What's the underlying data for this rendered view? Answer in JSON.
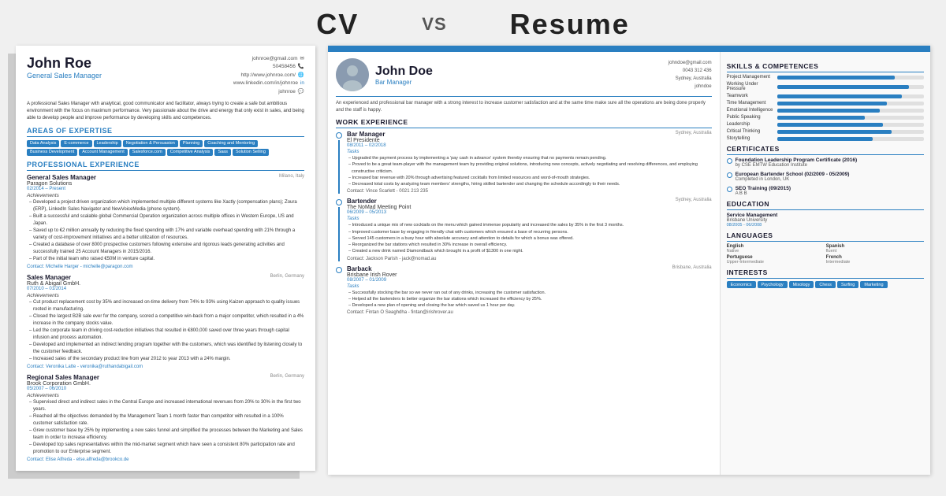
{
  "header": {
    "cv_label": "CV",
    "vs_label": "VS",
    "resume_label": "Resume"
  },
  "cv": {
    "name": "John Roe",
    "title": "General Sales Manager",
    "contact": {
      "email": "johnroe@gmail.com",
      "phone": "50458456",
      "website": "http://www.johnroe.com/",
      "linkedin": "www.linkedin.com/in/johnroe",
      "skype": "johnroe"
    },
    "summary": "A professional Sales Manager with analytical, good communicator and facilitator, always trying to create a safe but ambitious environment with the focus on maximum performance. Very passionate about the drive and energy that only exist in sales, and being able to develop people and improve performance by developing skills and competences.",
    "sections": {
      "expertise": "AREAS OF EXPERTISE",
      "experience": "PROFESSIONAL EXPERIENCE"
    },
    "tags": [
      "Data Analysis",
      "E-commerce",
      "Leadership",
      "Negotiation & Persuasion",
      "Planning",
      "Coaching and Mentoring",
      "Business Development",
      "Account Management",
      "Salesforce.com",
      "Competitive Analysis",
      "Saas",
      "Solution Selling"
    ],
    "jobs": [
      {
        "title": "General Sales Manager",
        "company": "Paragon Solutions",
        "dates": "02/2014 – Present",
        "location": "Milano, Italy",
        "achievements": [
          "Developed a project driven organization which implemented multiple different systems like Xactly (compensation plans); Zoura (ERP), LinkedIn Sales Navigator and NewVoiceMedia (phone system).",
          "Built a successful and scalable global Commercial Operation organization across multiple offices in Western Europe, US and Japan.",
          "Saved up to €2 million annually by reducing the fixed spending with 17% and variable overhead spending with 21% through a variety of cost-improvement initiatives and a better utilization of resources.",
          "Created a database of over 8000 prospective customers following extensive and rigorous leads generating activities and successfully trained 25 Account Managers in 2015/2016.",
          "Part of the initial team who raised €50M in venture capital."
        ],
        "contact": "Michelle Harger - michelle@paragon.com"
      },
      {
        "title": "Sales Manager",
        "company": "Ruth & Abigail GmbH.",
        "dates": "07/2010 – 01/2014",
        "location": "Berlin, Germany",
        "achievements": [
          "Cut product replacement cost by 35% and increased on-time delivery from 74% to 93% using Kaizen approach to quality issues rooted in manufacturing.",
          "Closed the largest B2B sale ever for the company, scored a competitive win-back from a major competitor, which resulted in a 4% increase in the company stocks value.",
          "Led the corporate team in driving cost-reduction initiatives that resulted in €800,000 saved over three years through capital infusion and process automation.",
          "Developed and implemented an indirect lending program together with the customers, which was identified by listening closely to the customer feedback.",
          "Increased sales of the secondary product line from year 2012 to year 2013 with a 24% margin."
        ],
        "contact": "Veronika Latte - veronika@ruthandabigail.com"
      },
      {
        "title": "Regional Sales Manager",
        "company": "Brook Corporation GmbH.",
        "dates": "05/2007 – 06/2010",
        "location": "Berlin, Germany",
        "achievements": [
          "Supervised direct and indirect sales in the Central Europe and increased international revenues from 20% to 30% in the first two years.",
          "Reached all the objectives demanded by the Management Team 1 month faster than competitor with resulted in a 100% customer satisfaction rate.",
          "Grew customer base by 25% by implementing a new sales funnel and simplified the processes between the Marketing and Sales team in order to increase efficiency.",
          "Developed top sales representatives within the mid-market segment which have seen a consistent 80% participation rate and promotion to our Enterprise segment."
        ],
        "contact": "Elise Alfreda - else.alfreda@brookco.de"
      }
    ]
  },
  "resume": {
    "name": "John Doe",
    "title": "Bar Manager",
    "contact": {
      "email": "johndoe@gmail.com",
      "phone": "0043 312 436",
      "location": "Sydney, Australia",
      "social": "johndoe"
    },
    "summary": "An experienced and professional bar manager with a strong interest to increase customer satisfaction and at the same time make sure all the operations are being done properly and the staff is happy.",
    "sections": {
      "work": "WORK EXPERIENCE",
      "skills": "SKILLS & COMPETENCES",
      "certificates": "CERTIFICATES",
      "education": "EDUCATION",
      "languages": "LANGUAGES",
      "interests": "INTERESTS"
    },
    "jobs": [
      {
        "title": "Bar Manager",
        "company": "El Presidente",
        "dates": "08/2011 – 02/2018",
        "location": "Sydney, Australia",
        "tasks": [
          "Upgraded the payment process by implementing a 'pay cash in advance' system thereby ensuring that no payments remain pending.",
          "Proved to be a great team-player with the management team by providing original solutions, introducing new concepts, actively negotiating and resolving differences, and employing constructive criticism.",
          "Increased bar revenue with 20% through advertising featured cocktails from limited resources and word-of-mouth strategies.",
          "Decreased total costs by analyzing team members' strengths, hiring skilled bartender and changing the schedule accordingly to their needs."
        ],
        "contact": "Vince Scarlett - 0021 213 235"
      },
      {
        "title": "Bartender",
        "company": "The NoMad Meeting Point",
        "dates": "06/2009 – 05/2013",
        "location": "Sydney, Australia",
        "tasks": [
          "Introduced a unique mix of new cocktails on the menu which gained immense popularity and increased the sales by 35% in the first 3 months.",
          "Improved customer base by engaging in friendly chat with customers which ensured a base of recurring persons.",
          "Served 145 customers in a busy hour with absolute accuracy and attention to details for which a bonus was offered.",
          "Reorganized the bar stations which resulted in 30% increase in overall efficiency.",
          "Created a new drink named Diamondback which brought in a profit of $1300 in one night."
        ],
        "contact": "Jackson Parish - jack@nomad.au"
      },
      {
        "title": "Barback",
        "company": "Brisbane Irish Rover",
        "dates": "08/2007 – 01/2009",
        "location": "Brisbane, Australia",
        "tasks": [
          "Successfully stocking the bar so we never ran out of any drinks, increasing the customer satisfaction.",
          "Helped all the bartenders to better organize the bar stations which increased the efficiency by 25%.",
          "Developed a new plan of opening and closing the bar which saved us 1 hour per day."
        ],
        "contact": "Fintan O Seaghdha - fintan@irishrover.au"
      }
    ],
    "skills": [
      {
        "name": "Project Management",
        "pct": 80
      },
      {
        "name": "Working Under Pressure",
        "pct": 90
      },
      {
        "name": "Teamwork",
        "pct": 85
      },
      {
        "name": "Time Management",
        "pct": 75
      },
      {
        "name": "Emotional Intelligence",
        "pct": 70
      },
      {
        "name": "Public Speaking",
        "pct": 60
      },
      {
        "name": "Leadership",
        "pct": 72
      },
      {
        "name": "Critical Thinking",
        "pct": 78
      },
      {
        "name": "Storytelling",
        "pct": 65
      }
    ],
    "certificates": [
      {
        "title": "Foundation Leadership Program Certificate (2016)",
        "subtitle": "by CSE EMTW Education Institute"
      },
      {
        "title": "European Bartender School (02/2009 - 05/2009)",
        "subtitle": "Completed in London, UK"
      },
      {
        "title": "SEO Training (09/2015)",
        "subtitle": "A B B"
      }
    ],
    "education": [
      {
        "title": "Service Management",
        "school": "Brisbane University",
        "dates": "08/2005 - 06/2008"
      }
    ],
    "languages": [
      {
        "name": "English",
        "level": "Native"
      },
      {
        "name": "Spanish",
        "level": "fluent"
      },
      {
        "name": "Portuguese",
        "level": "Upper-Intermediate"
      },
      {
        "name": "French",
        "level": "Intermediate"
      }
    ],
    "interests": [
      "Economics",
      "Psychology",
      "Mixology",
      "Chess",
      "Surfing",
      "Marketing"
    ]
  }
}
